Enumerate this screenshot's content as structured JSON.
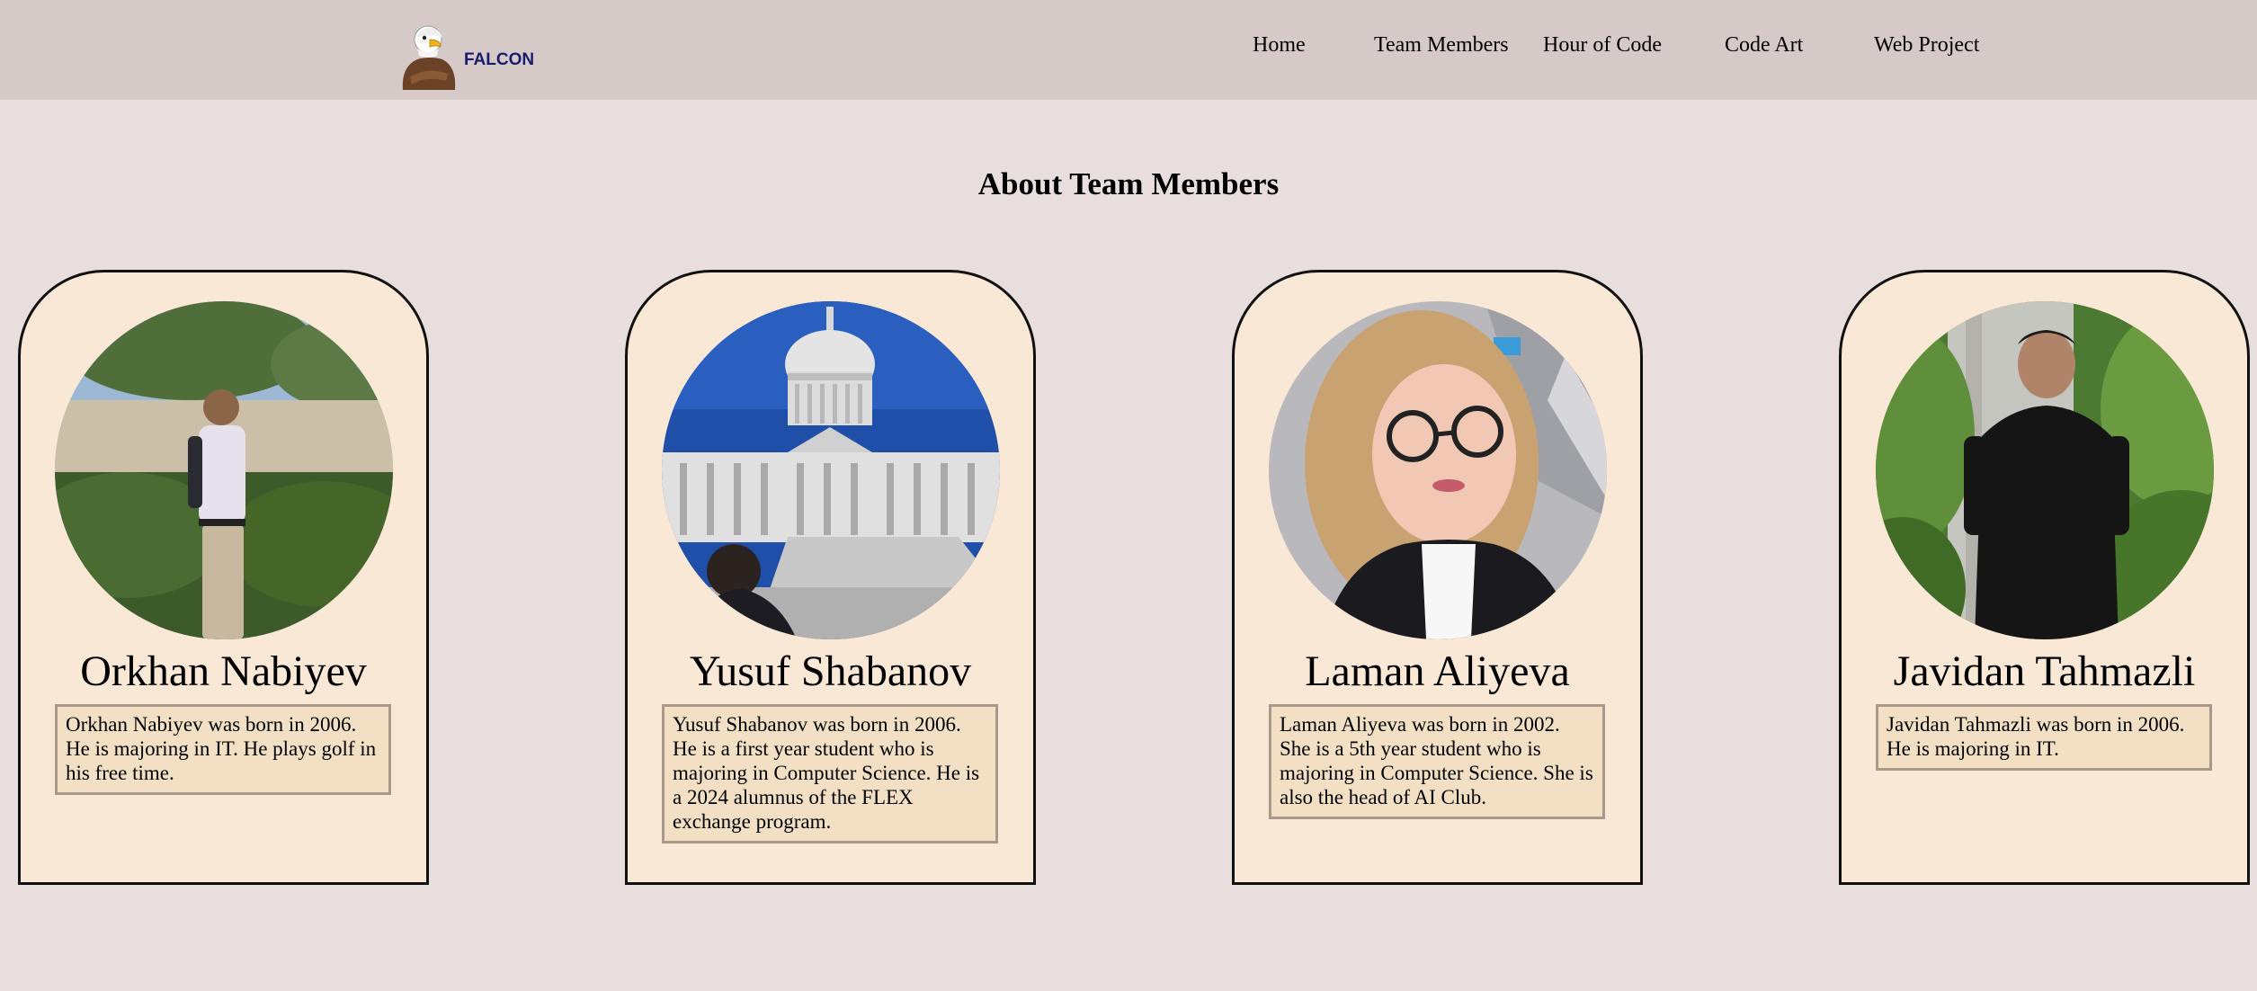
{
  "header": {
    "logo_text": "FALCON",
    "nav": [
      {
        "label": "Home"
      },
      {
        "label": "Team Members"
      },
      {
        "label": "Hour of Code"
      },
      {
        "label": "Code Art"
      },
      {
        "label": "Web Project"
      }
    ]
  },
  "main": {
    "title": "About Team Members",
    "members": [
      {
        "name": "Orkhan Nabiyev",
        "bio": "Orkhan Nabiyev was born in 2006. He is majoring in IT. He plays golf in his free time."
      },
      {
        "name": "Yusuf Shabanov",
        "bio": "Yusuf Shabanov was born in 2006. He is a first year student who is majoring in Computer Science. He is a 2024 alumnus of the FLEX exchange program."
      },
      {
        "name": "Laman Aliyeva",
        "bio": "Laman Aliyeva was born in 2002. She is a 5th year student who is majoring in Computer Science. She is also the head of AI Club."
      },
      {
        "name": "Javidan Tahmazli",
        "bio": "Javidan Tahmazli was born in 2006. He is majoring in IT."
      }
    ]
  },
  "colors": {
    "page_bg": "#e8dedd",
    "navbar_bg": "#d6cac9",
    "card_bg": "#f9e8d5",
    "bio_bg": "#f2dfc4",
    "bio_border": "#a9998a",
    "logo_text": "#1b1b6e"
  }
}
